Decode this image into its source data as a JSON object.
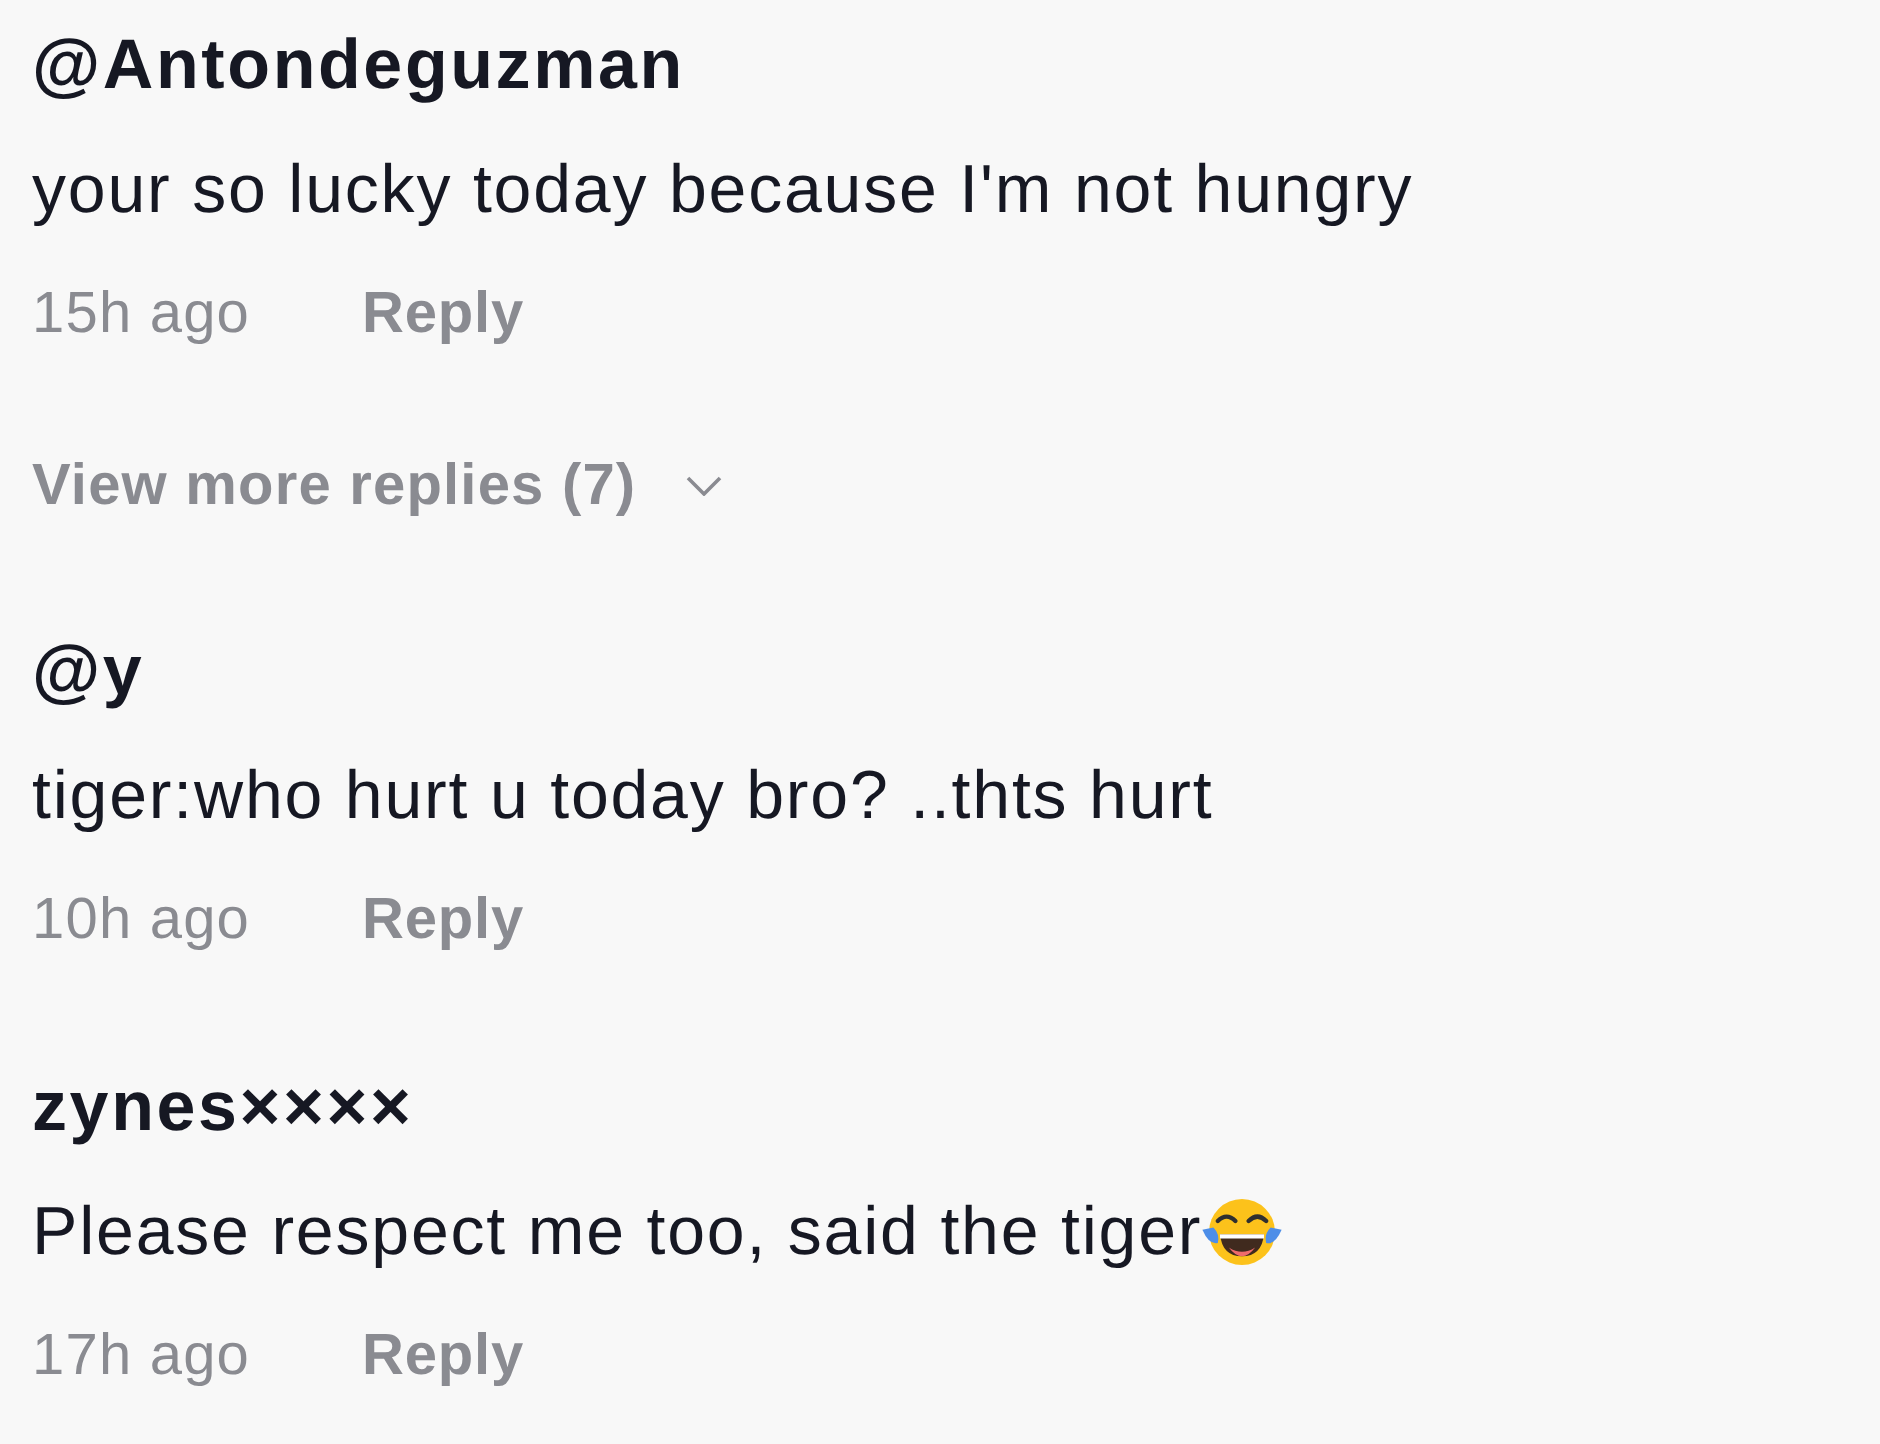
{
  "comments": [
    {
      "username": "@Antondeguzman",
      "text": "your so lucky today because I'm not hungry",
      "emoji": false,
      "time": "15h ago",
      "reply": "Reply",
      "more_replies": "View more replies (7)"
    },
    {
      "username": "@y",
      "text": "tiger:who hurt u today bro? ..thts hurt",
      "emoji": false,
      "time": "10h ago",
      "reply": "Reply"
    },
    {
      "username": "zynes××××",
      "text": "Please respect me too, said the tiger",
      "emoji": true,
      "time": "17h ago",
      "reply": "Reply"
    }
  ]
}
